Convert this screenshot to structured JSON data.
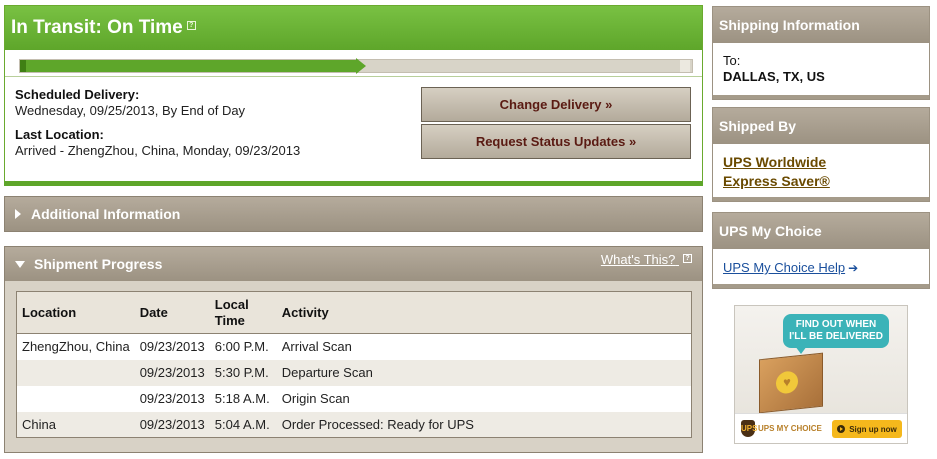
{
  "status": {
    "title": "In Transit: On Time",
    "help_glyph": "?",
    "progress_fraction": 0.5,
    "scheduled_label": "Scheduled Delivery:",
    "scheduled_value": "Wednesday, 09/25/2013, By End of Day",
    "last_location_label": "Last Location:",
    "last_location_value": "Arrived - ZhengZhou, China, Monday, 09/23/2013",
    "buttons": {
      "change_delivery": "Change Delivery »",
      "request_updates": "Request Status Updates »"
    }
  },
  "additional_info": {
    "label": "Additional Information"
  },
  "shipment_progress": {
    "label": "Shipment Progress",
    "whats_this": "What's This?",
    "columns": [
      "Location",
      "Date",
      "Local Time",
      "Activity"
    ],
    "rows": [
      {
        "location": "ZhengZhou, China",
        "date": "09/23/2013",
        "time": "6:00 P.M.",
        "activity": "Arrival Scan"
      },
      {
        "location": "",
        "date": "09/23/2013",
        "time": "5:30 P.M.",
        "activity": "Departure Scan"
      },
      {
        "location": "",
        "date": "09/23/2013",
        "time": "5:18 A.M.",
        "activity": "Origin Scan"
      },
      {
        "location": "China",
        "date": "09/23/2013",
        "time": "5:04 A.M.",
        "activity": "Order Processed: Ready for UPS"
      }
    ]
  },
  "sidebar": {
    "shipping_info": {
      "title": "Shipping Information",
      "to_label": "To:",
      "to_value": "DALLAS, TX, US"
    },
    "shipped_by": {
      "title": "Shipped By",
      "service_line1": "UPS Worldwide",
      "service_line2": "Express Saver®"
    },
    "my_choice": {
      "title": "UPS My Choice",
      "help_link": "UPS My Choice Help",
      "arrow_glyph": "➔"
    },
    "promo": {
      "bubble_line1": "FIND OUT WHEN",
      "bubble_line2": "I'LL BE DELIVERED",
      "brand": "UPS MY CHOICE",
      "logo_text": "UPS",
      "signup": "Sign up now"
    }
  },
  "colors": {
    "status_green": "#5ea62a",
    "panel_taupe": "#a59b8a",
    "button_text": "#5a1a12",
    "link_blue": "#1a4f9c",
    "service_brown": "#6a4a00"
  }
}
